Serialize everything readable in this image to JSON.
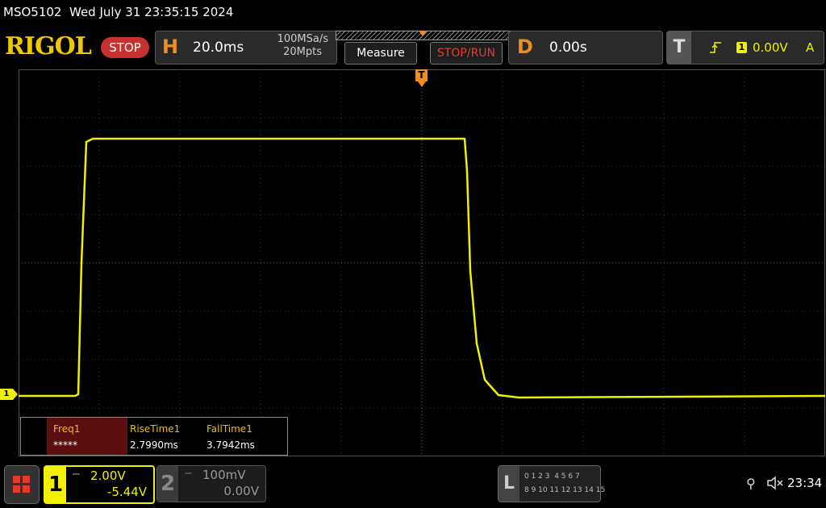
{
  "topbar": {
    "model": "MSO5102",
    "datetime": "Wed July 31 23:35:15 2024"
  },
  "brand": {
    "logo": "RIGOL",
    "status": "STOP"
  },
  "horizontal": {
    "letter": "H",
    "timebase": "20.0ms",
    "sample_rate": "100MSa/s",
    "memory_depth": "20Mpts"
  },
  "buttons": {
    "measure": "Measure",
    "stoprun": "STOP/RUN"
  },
  "delay": {
    "letter": "D",
    "value": "0.00s"
  },
  "trigger": {
    "letter": "T",
    "channel": "1",
    "level": "0.00V",
    "mode": "A"
  },
  "trace": {
    "channel_marker": "1",
    "trigger_pos_marker": "T"
  },
  "measurements": {
    "headers": [
      "Freq1",
      "RiseTime1",
      "FallTime1"
    ],
    "values": [
      "*****",
      "2.7990ms",
      "3.7942ms"
    ]
  },
  "channel1": {
    "num": "1",
    "scale": "2.00V",
    "offset": "-5.44V"
  },
  "channel2": {
    "num": "2",
    "scale": "100mV",
    "offset": "0.00V"
  },
  "logic": {
    "letter": "L",
    "row1": "0 1 2 3  4 5 6 7",
    "row2": "8 9 10 11 12 13 14 15"
  },
  "status": {
    "time": "23:34"
  },
  "colors": {
    "trace": "#f0f000",
    "grid": "#3c3c3c",
    "accent": "#f08c20",
    "stop": "#c8322e"
  }
}
